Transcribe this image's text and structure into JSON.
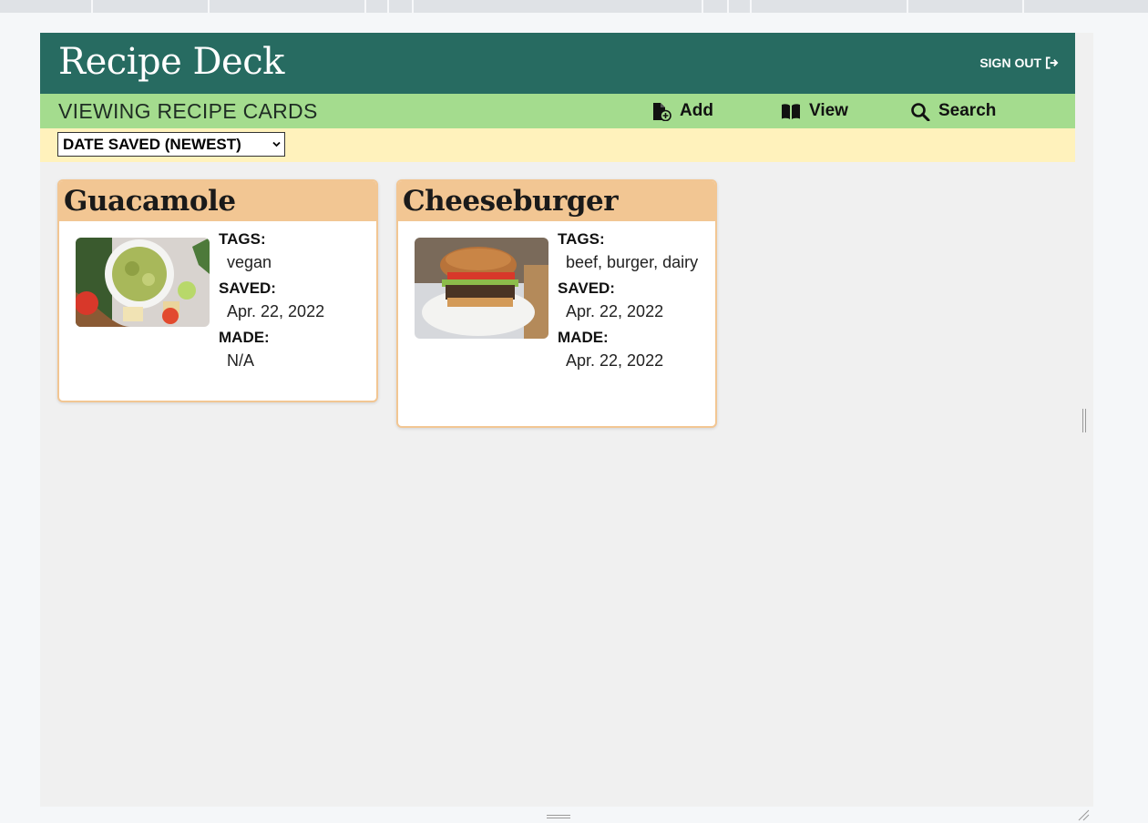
{
  "header": {
    "app_title": "Recipe Deck",
    "signout_label": "SIGN OUT"
  },
  "subbar": {
    "title": "VIEWING RECIPE CARDS",
    "nav": [
      {
        "label": "Add",
        "icon": "file-plus-icon"
      },
      {
        "label": "View",
        "icon": "book-open-icon"
      },
      {
        "label": "Search",
        "icon": "search-icon"
      }
    ]
  },
  "sort": {
    "selected": "DATE SAVED (NEWEST)"
  },
  "labels": {
    "tags": "TAGS:",
    "saved": "SAVED:",
    "made": "MADE:"
  },
  "cards": [
    {
      "title": "Guacamole",
      "image": "guacamole-photo",
      "tags": "vegan",
      "saved": "Apr. 22, 2022",
      "made": "N/A"
    },
    {
      "title": "Cheeseburger",
      "image": "cheeseburger-photo",
      "tags": "beef, burger, dairy",
      "saved": "Apr. 22, 2022",
      "made": "Apr. 22, 2022"
    }
  ],
  "colors": {
    "header_bg": "#276b61",
    "subbar_bg": "#a4dc8e",
    "sortbar_bg": "#fff2bc",
    "card_accent": "#f2c693",
    "page_bg": "#f0f0f0"
  }
}
